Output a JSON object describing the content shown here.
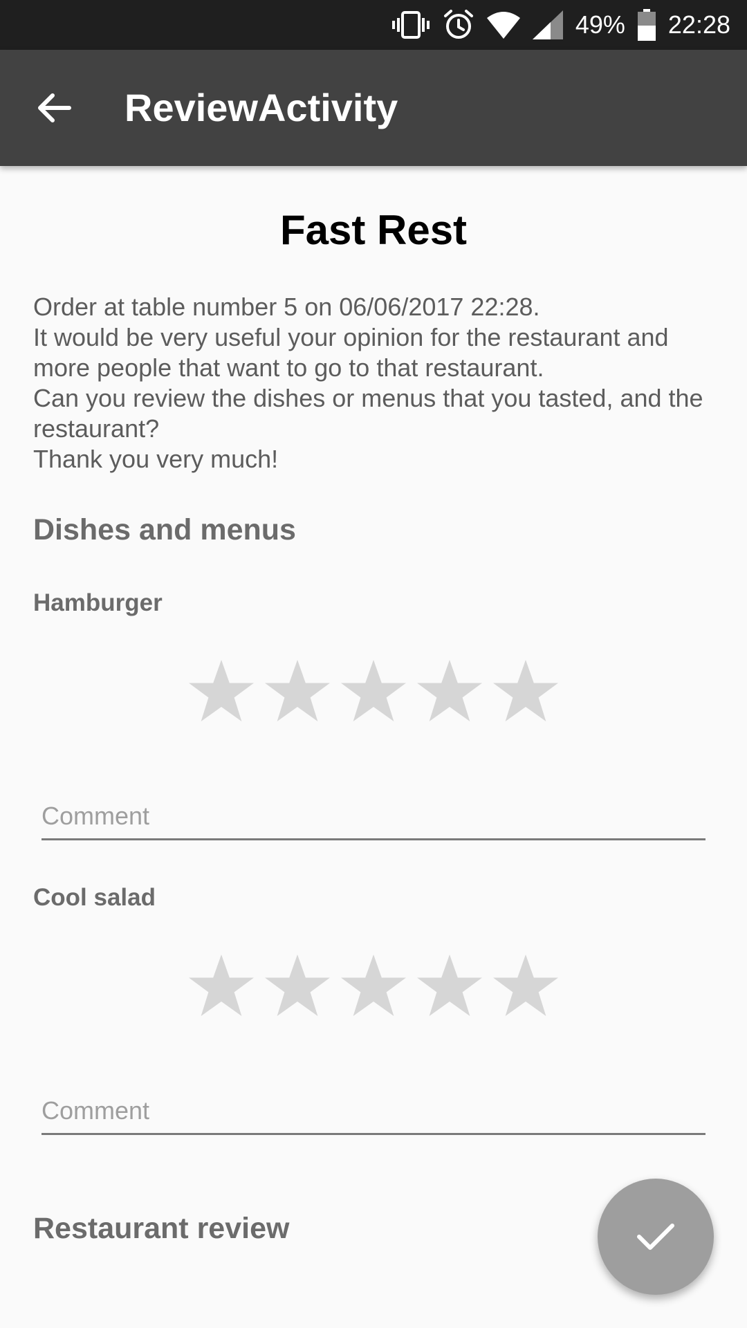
{
  "status_bar": {
    "battery_percent": "49%",
    "time": "22:28",
    "icons": [
      "vibrate-icon",
      "alarm-icon",
      "wifi-icon",
      "cellular-signal-icon",
      "battery-icon"
    ]
  },
  "app_bar": {
    "title": "ReviewActivity",
    "back_icon": "arrow-back-icon"
  },
  "restaurant": {
    "name": "Fast Rest"
  },
  "intro": {
    "lines": [
      "Order at table number 5 on 06/06/2017 22:28.",
      "It would be very useful your opinion for the restaurant and more people that want to go to that restaurant.",
      "Can you review the dishes or menus that you tasted, and the restaurant?",
      "Thank you very much!"
    ]
  },
  "dishes_section": {
    "title": "Dishes and menus",
    "items": [
      {
        "name": "Hamburger",
        "rating": 0,
        "max_rating": 5,
        "comment_placeholder": "Comment",
        "comment_value": ""
      },
      {
        "name": "Cool salad",
        "rating": 0,
        "max_rating": 5,
        "comment_placeholder": "Comment",
        "comment_value": ""
      }
    ]
  },
  "restaurant_section": {
    "title": "Restaurant review"
  },
  "fab": {
    "icon": "check-icon"
  },
  "colors": {
    "status_bar": "#1f1f1f",
    "app_bar": "#424242",
    "background": "#fafafa",
    "star_empty": "#d6d6d6",
    "fab": "#9e9e9e",
    "secondary_text": "#6b6b6b"
  }
}
